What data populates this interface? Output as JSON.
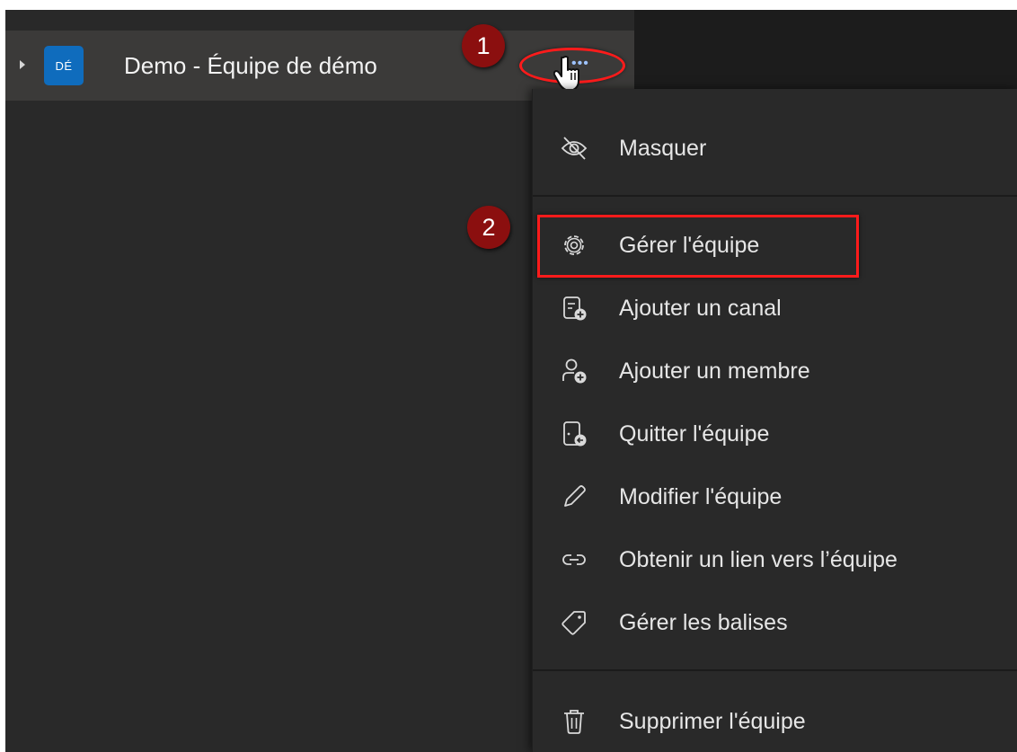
{
  "team": {
    "avatar_initials": "DÉ",
    "name": "Demo - Équipe de démo"
  },
  "annotations": {
    "step1": "1",
    "step2": "2"
  },
  "menu": {
    "items": [
      {
        "label": "Masquer",
        "icon": "eye-off-icon"
      },
      {
        "label": "Gérer l'équipe",
        "icon": "gear-icon"
      },
      {
        "label": "Ajouter un canal",
        "icon": "add-channel-icon"
      },
      {
        "label": "Ajouter un membre",
        "icon": "add-member-icon"
      },
      {
        "label": "Quitter l'équipe",
        "icon": "leave-team-icon"
      },
      {
        "label": "Modifier l'équipe",
        "icon": "pencil-icon"
      },
      {
        "label": "Obtenir un lien vers l’équipe",
        "icon": "link-icon"
      },
      {
        "label": "Gérer les balises",
        "icon": "tag-icon"
      },
      {
        "label": "Supprimer l'équipe",
        "icon": "trash-icon"
      }
    ]
  },
  "colors": {
    "background": "#292929",
    "row_highlight": "#3b3a39",
    "avatar": "#0f6cbd",
    "annotation_red": "#ff1b1b",
    "badge": "#8b0f0f"
  }
}
